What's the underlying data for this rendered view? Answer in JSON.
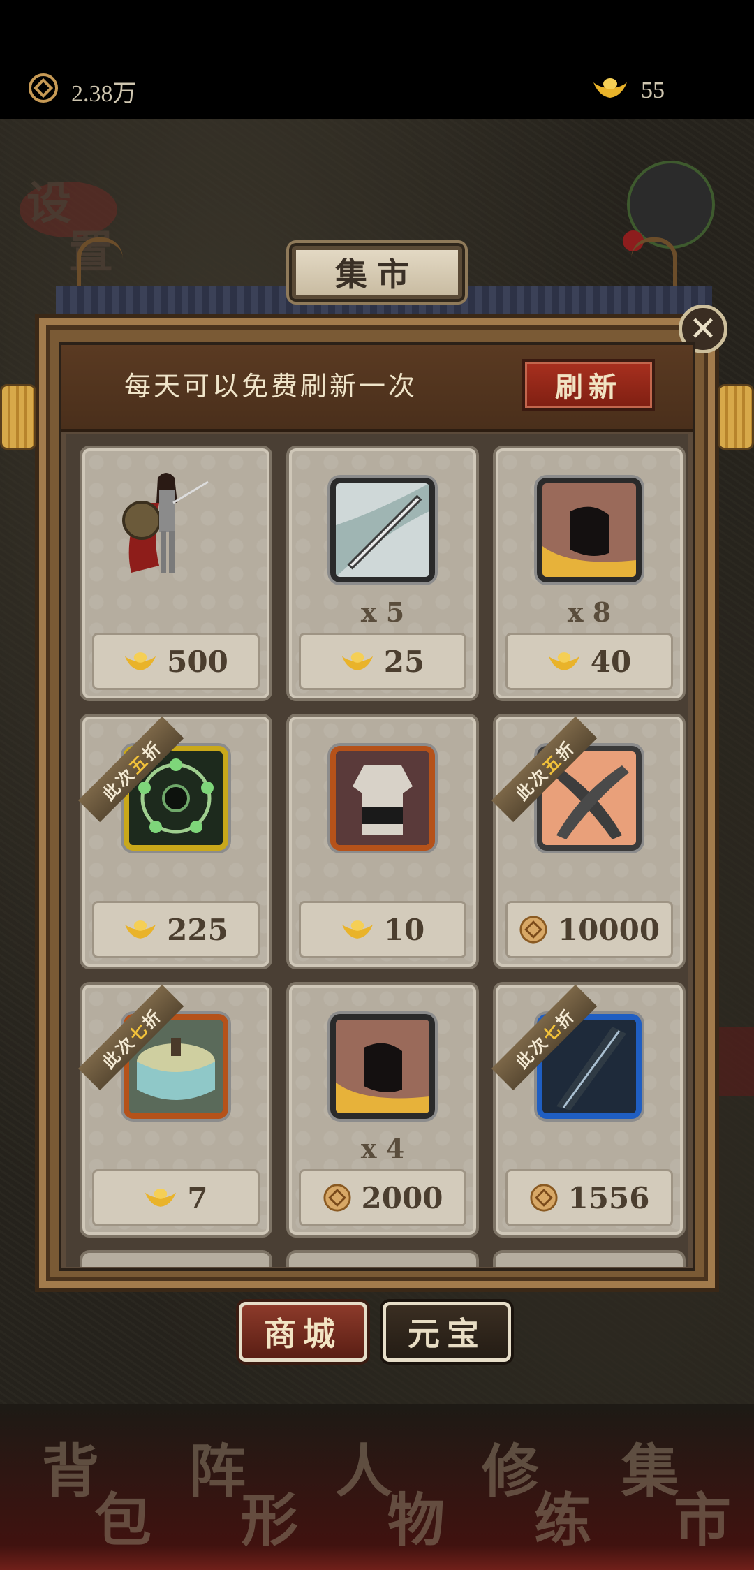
{
  "top_bar": {
    "copper_amount": "2.38万",
    "ingot_amount": "55"
  },
  "map": {
    "settings_label": [
      "设",
      "置"
    ]
  },
  "dialog": {
    "title": "集市",
    "notice": "每天可以免费刷新一次",
    "refresh_label": "刷新",
    "close_icon": "close-icon"
  },
  "items": [
    {
      "icon": "female-warrior-portrait",
      "qty": "",
      "currency": "ingot",
      "price": "500",
      "ribbon": null
    },
    {
      "icon": "sword-icon",
      "qty": "x 5",
      "currency": "ingot",
      "price": "25",
      "ribbon": null
    },
    {
      "icon": "fist-icon",
      "qty": "x 8",
      "currency": "ingot",
      "price": "40",
      "ribbon": null
    },
    {
      "icon": "orb-ring-icon",
      "qty": "",
      "currency": "ingot",
      "price": "225",
      "ribbon": [
        "此次",
        "五",
        "折"
      ]
    },
    {
      "icon": "armor-icon",
      "qty": "",
      "currency": "ingot",
      "price": "10",
      "ribbon": null
    },
    {
      "icon": "crossed-blades-icon",
      "qty": "",
      "currency": "copper",
      "price": "10000",
      "ribbon": [
        "此次",
        "五",
        "折"
      ]
    },
    {
      "icon": "drum-icon",
      "qty": "",
      "currency": "ingot",
      "price": "7",
      "ribbon": [
        "此次",
        "七",
        "折"
      ]
    },
    {
      "icon": "fist-icon",
      "qty": "x 4",
      "currency": "copper",
      "price": "2000",
      "ribbon": null
    },
    {
      "icon": "dark-blade-icon",
      "qty": "",
      "currency": "copper",
      "price": "1556",
      "ribbon": [
        "此次",
        "七",
        "折"
      ]
    }
  ],
  "tabs": {
    "shop": "商城",
    "yuanbao": "元宝"
  },
  "bottom_nav": [
    {
      "ch1": "背",
      "ch2": "包"
    },
    {
      "ch1": "阵",
      "ch2": "形"
    },
    {
      "ch1": "人",
      "ch2": "物"
    },
    {
      "ch1": "修",
      "ch2": "练"
    },
    {
      "ch1": "集",
      "ch2": "市"
    }
  ],
  "colors": {
    "ingot_gold": "#e9b32a",
    "copper": "#c79a55",
    "refresh_red": "#9a2a1a"
  }
}
